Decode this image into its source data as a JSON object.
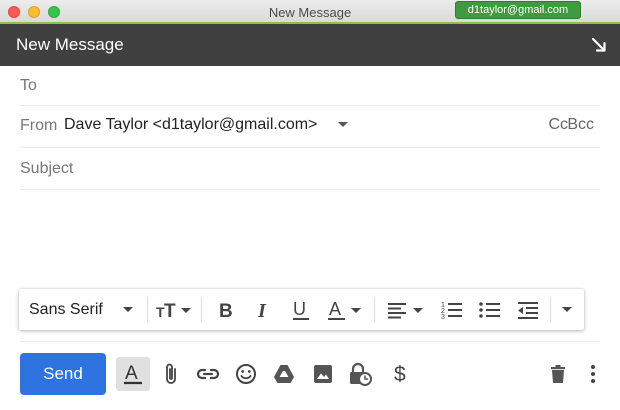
{
  "window": {
    "title": "New Message",
    "account": "d1taylor@gmail.com"
  },
  "compose": {
    "header_title": "New Message",
    "expand_icon": "expand-arrow-icon"
  },
  "fields": {
    "to_label": "To",
    "from_label": "From",
    "from_value": "Dave Taylor <d1taylor@gmail.com>",
    "cc_label": "Cc",
    "bcc_label": "Bcc",
    "subject_placeholder": "Subject"
  },
  "toolbar": {
    "font_family": "Sans Serif",
    "items": [
      "text-size-icon",
      "bold-icon",
      "italic-icon",
      "underline-icon",
      "text-color-icon",
      "align-icon",
      "numbered-list-icon",
      "bulleted-list-icon",
      "indent-less-icon",
      "more-formatting-icon"
    ]
  },
  "actions": {
    "send_label": "Send",
    "icons": [
      "formatting-options-icon",
      "attach-icon",
      "link-icon",
      "emoji-icon",
      "drive-icon",
      "photo-icon",
      "confidential-icon",
      "money-icon",
      "trash-icon",
      "more-options-icon"
    ]
  },
  "colors": {
    "send_button": "#2e73e0",
    "header_bg": "#404040",
    "account_badge": "#3f9b3f"
  }
}
